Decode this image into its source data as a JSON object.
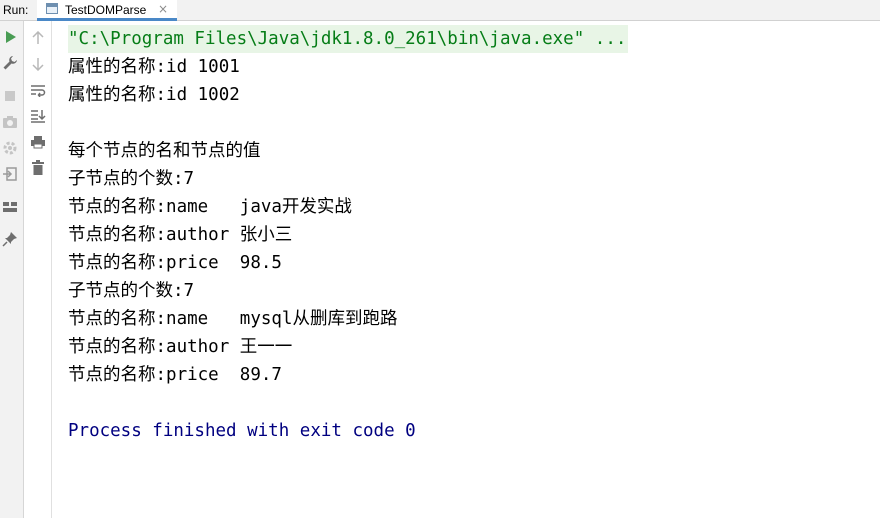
{
  "run_bar": {
    "label": "Run:",
    "tab": {
      "label": "TestDOMParse",
      "close": "×"
    }
  },
  "toolbar": {
    "left": [
      "run-icon",
      "wrench-icon",
      "stop-icon",
      "camera-icon",
      "gear-icon",
      "exit-icon",
      "layout-icon",
      "pin-icon"
    ],
    "right": [
      "up-arrow-icon",
      "down-arrow-icon",
      "soft-wrap-icon",
      "scroll-to-end-icon",
      "print-icon",
      "trash-icon"
    ]
  },
  "console": {
    "lines": [
      "\"C:\\Program Files\\Java\\jdk1.8.0_261\\bin\\java.exe\" ...",
      "属性的名称:id 1001",
      "属性的名称:id 1002",
      "",
      "每个节点的名和节点的值",
      "子节点的个数:7",
      "节点的名称:name   java开发实战",
      "节点的名称:author 张小三",
      "节点的名称:price  98.5",
      "子节点的个数:7",
      "节点的名称:name   mysql从删库到跑路",
      "节点的名称:author 王一一",
      "节点的名称:price  89.7",
      "",
      "Process finished with exit code 0"
    ]
  },
  "colors": {
    "command_text": "#067d17",
    "command_bg": "#e8f5e6",
    "exit_text": "#000080",
    "run_green": "#499c54"
  }
}
